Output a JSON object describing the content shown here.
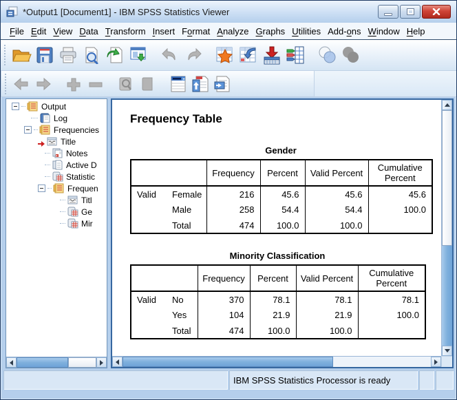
{
  "window": {
    "title": "*Output1 [Document1] - IBM SPSS Statistics Viewer",
    "controls": {
      "minimize": "minimize",
      "restore": "restore",
      "close": "close"
    }
  },
  "menu": {
    "items": [
      {
        "pre": "",
        "mn": "F",
        "post": "ile"
      },
      {
        "pre": "",
        "mn": "E",
        "post": "dit"
      },
      {
        "pre": "",
        "mn": "V",
        "post": "iew"
      },
      {
        "pre": "",
        "mn": "D",
        "post": "ata"
      },
      {
        "pre": "",
        "mn": "T",
        "post": "ransform"
      },
      {
        "pre": "",
        "mn": "I",
        "post": "nsert"
      },
      {
        "pre": "F",
        "mn": "o",
        "post": "rmat"
      },
      {
        "pre": "",
        "mn": "A",
        "post": "nalyze"
      },
      {
        "pre": "",
        "mn": "G",
        "post": "raphs"
      },
      {
        "pre": "",
        "mn": "U",
        "post": "tilities"
      },
      {
        "pre": "Add-",
        "mn": "o",
        "post": "ns"
      },
      {
        "pre": "",
        "mn": "W",
        "post": "indow"
      },
      {
        "pre": "",
        "mn": "H",
        "post": "elp"
      }
    ]
  },
  "toolbar_main": {
    "icons": [
      "open-file",
      "save-file",
      "print",
      "print-preview",
      "export-output",
      "designate-window",
      "undo",
      "redo",
      "goto-case",
      "recall-dialogs",
      "insert-variables",
      "variables",
      "use-variable-sets",
      "show-all-variables"
    ]
  },
  "toolbar_outline": {
    "icons": [
      "previous-item",
      "next-item",
      "promote",
      "demote",
      "show-item",
      "hide-item",
      "pivot-table",
      "insert-heading",
      "insert-text"
    ]
  },
  "outline": {
    "items": [
      {
        "label": "Output",
        "icon": "output-book"
      },
      {
        "label": "Log",
        "icon": "log-book"
      },
      {
        "label": "Frequencies",
        "icon": "procedure-book"
      },
      {
        "label": "Title",
        "icon": "title-pad",
        "current": true
      },
      {
        "label": "Notes",
        "icon": "notes"
      },
      {
        "label": "Active D",
        "icon": "dataset-page"
      },
      {
        "label": "Statistic",
        "icon": "stats-table"
      },
      {
        "label": "Frequen",
        "icon": "procedure-book"
      },
      {
        "label": "Titl",
        "icon": "title-pad"
      },
      {
        "label": "Ge",
        "icon": "stats-table"
      },
      {
        "label": "Mir",
        "icon": "stats-table"
      }
    ]
  },
  "content": {
    "heading": "Frequency Table",
    "tables": [
      {
        "title": "Gender",
        "stub_header": "",
        "stub": "Valid",
        "columns": [
          "Frequency",
          "Percent",
          "Valid Percent",
          "Cumulative Percent"
        ],
        "rows": [
          {
            "label": "Female",
            "frequency": "216",
            "percent": "45.6",
            "valid_percent": "45.6",
            "cumulative_percent": "45.6"
          },
          {
            "label": "Male",
            "frequency": "258",
            "percent": "54.4",
            "valid_percent": "54.4",
            "cumulative_percent": "100.0"
          },
          {
            "label": "Total",
            "frequency": "474",
            "percent": "100.0",
            "valid_percent": "100.0",
            "cumulative_percent": ""
          }
        ]
      },
      {
        "title": "Minority Classification",
        "stub_header": "",
        "stub": "Valid",
        "columns": [
          "Frequency",
          "Percent",
          "Valid Percent",
          "Cumulative Percent"
        ],
        "rows": [
          {
            "label": "No",
            "frequency": "370",
            "percent": "78.1",
            "valid_percent": "78.1",
            "cumulative_percent": "78.1"
          },
          {
            "label": "Yes",
            "frequency": "104",
            "percent": "21.9",
            "valid_percent": "21.9",
            "cumulative_percent": "100.0"
          },
          {
            "label": "Total",
            "frequency": "474",
            "percent": "100.0",
            "valid_percent": "100.0",
            "cumulative_percent": ""
          }
        ]
      }
    ]
  },
  "status": {
    "message": "IBM SPSS Statistics Processor is ready"
  },
  "colors": {
    "accent_blue": "#3667a0",
    "titlebar_blue": "#cfe1f5",
    "close_red": "#cf4437",
    "disabled_gray": "#b4b4b4",
    "folder_orange": "#f6c455",
    "table_border": "#000000"
  }
}
